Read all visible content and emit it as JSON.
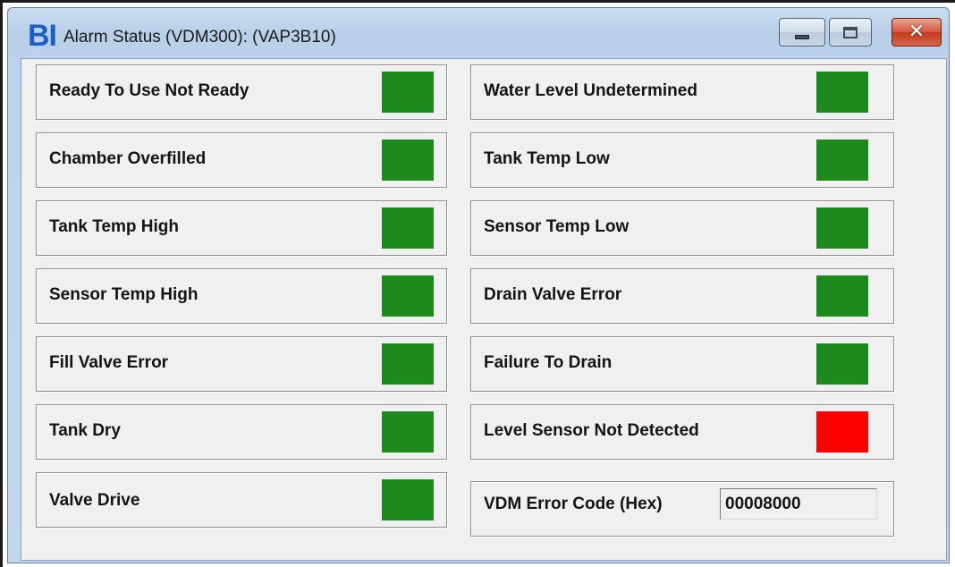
{
  "window": {
    "logo": "BI",
    "title": "Alarm Status (VDM300): (VAP3B10)"
  },
  "colors": {
    "ok": "#1e8a1e",
    "alarm": "#ff0000"
  },
  "left_column": [
    {
      "label": "Ready To Use Not Ready",
      "status": "ok"
    },
    {
      "label": "Chamber Overfilled",
      "status": "ok"
    },
    {
      "label": "Tank Temp High",
      "status": "ok"
    },
    {
      "label": "Sensor Temp High",
      "status": "ok"
    },
    {
      "label": "Fill Valve Error",
      "status": "ok"
    },
    {
      "label": "Tank Dry",
      "status": "ok"
    },
    {
      "label": "Valve Drive",
      "status": "ok"
    }
  ],
  "right_column": [
    {
      "label": "Water Level Undetermined",
      "status": "ok"
    },
    {
      "label": "Tank Temp Low",
      "status": "ok"
    },
    {
      "label": "Sensor Temp Low",
      "status": "ok"
    },
    {
      "label": "Drain Valve Error",
      "status": "ok"
    },
    {
      "label": "Failure To Drain",
      "status": "ok"
    },
    {
      "label": "Level Sensor Not Detected",
      "status": "alarm"
    }
  ],
  "error_code": {
    "label": "VDM Error Code (Hex)",
    "value": "00008000"
  },
  "icons": {
    "minimize": "minimize-icon",
    "maximize": "maximize-icon",
    "close": "close-icon"
  }
}
